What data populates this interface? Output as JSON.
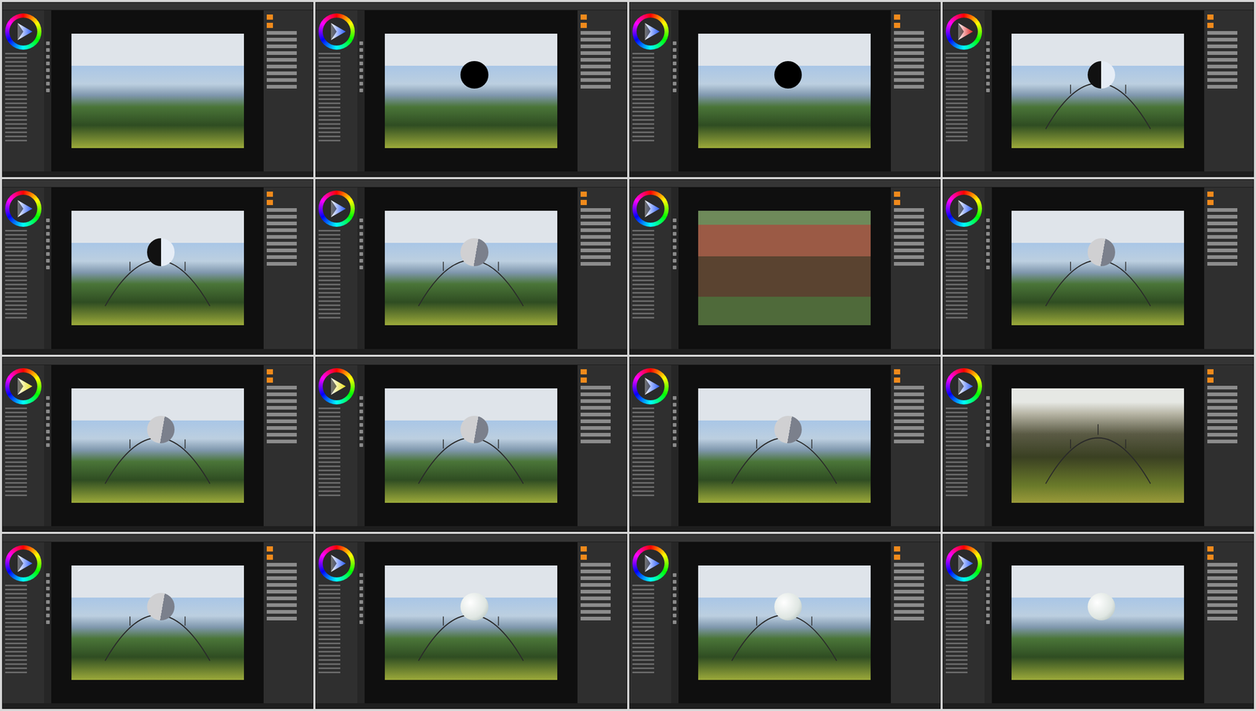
{
  "frames": [
    {
      "color": "#2a5cff",
      "scene": "landscape",
      "sphere": "none",
      "arc": false
    },
    {
      "color": "#2a5cff",
      "scene": "landscape",
      "sphere": "dark",
      "arc": false
    },
    {
      "color": "#2a5cff",
      "scene": "landscape",
      "sphere": "dark",
      "arc": false
    },
    {
      "color": "#e02424",
      "scene": "landscape",
      "sphere": "half",
      "arc": true
    },
    {
      "color": "#2a5cff",
      "scene": "landscape",
      "sphere": "half",
      "arc": true
    },
    {
      "color": "#2a5cff",
      "scene": "landscape",
      "sphere": "grey",
      "arc": true
    },
    {
      "color": "#2a5cff",
      "scene": "house",
      "sphere": "none",
      "arc": false
    },
    {
      "color": "#2a5cff",
      "scene": "landscape",
      "sphere": "grey",
      "arc": true
    },
    {
      "color": "#e8e01c",
      "scene": "landscape",
      "sphere": "grey",
      "arc": true
    },
    {
      "color": "#e8e01c",
      "scene": "landscape",
      "sphere": "grey",
      "arc": true
    },
    {
      "color": "#2a5cff",
      "scene": "landscape",
      "sphere": "grey",
      "arc": true
    },
    {
      "color": "#2a5cff",
      "scene": "sunset",
      "sphere": "none",
      "arc": true
    },
    {
      "color": "#2a5cff",
      "scene": "landscape",
      "sphere": "grey",
      "arc": true
    },
    {
      "color": "#2a5cff",
      "scene": "landscape",
      "sphere": "white",
      "arc": true
    },
    {
      "color": "#2a5cff",
      "scene": "landscape",
      "sphere": "white",
      "arc": true
    },
    {
      "color": "#2a5cff",
      "scene": "landscape",
      "sphere": "white",
      "arc": false
    }
  ]
}
